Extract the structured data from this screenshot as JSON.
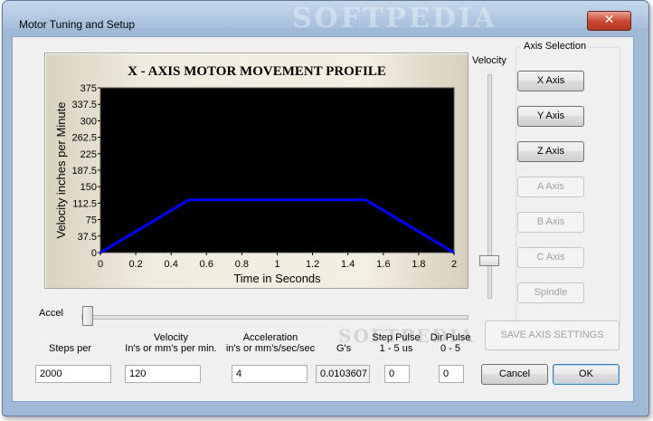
{
  "window": {
    "title": "Motor Tuning and Setup",
    "watermark": "SOFTPEDIA",
    "close_glyph": "✕"
  },
  "chart_data": {
    "type": "line",
    "title": "X - AXIS MOTOR MOVEMENT PROFILE",
    "xlabel": "Time in Seconds",
    "ylabel": "Velocity inches per Minute",
    "xlim": [
      0,
      2
    ],
    "ylim": [
      0,
      375
    ],
    "xticks": [
      "0",
      "0.2",
      "0.4",
      "0.6",
      "0.8",
      "1",
      "1.2",
      "1.4",
      "1.6",
      "1.8",
      "2"
    ],
    "yticks": [
      "0",
      "37.5",
      "75",
      "112.5",
      "150",
      "187.5",
      "225",
      "262.5",
      "300",
      "337.5",
      "375"
    ],
    "series": [
      {
        "x": [
          0,
          0.5,
          1.5,
          2
        ],
        "y": [
          0,
          120,
          120,
          0
        ],
        "color": "#0000ff"
      }
    ],
    "plot_background": "#000000",
    "grid": false
  },
  "sliders": {
    "velocity_label": "Velocity",
    "accel_label": "Accel"
  },
  "axis_selection": {
    "label": "Axis Selection",
    "buttons": [
      {
        "label": "X Axis",
        "enabled": true
      },
      {
        "label": "Y Axis",
        "enabled": true
      },
      {
        "label": "Z Axis",
        "enabled": true
      },
      {
        "label": "A Axis",
        "enabled": false
      },
      {
        "label": "B Axis",
        "enabled": false
      },
      {
        "label": "C Axis",
        "enabled": false
      },
      {
        "label": "Spindle",
        "enabled": false
      }
    ]
  },
  "fields": {
    "steps_per": {
      "label": "Steps per",
      "value": "2000"
    },
    "velocity": {
      "label_line1": "Velocity",
      "label_line2": "In's or mm's per min.",
      "value": "120"
    },
    "acceleration": {
      "label_line1": "Acceleration",
      "label_line2": "in's or mm's/sec/sec",
      "value": "4"
    },
    "gs": {
      "label": "G's",
      "value": "0.0103607"
    },
    "step_pulse": {
      "label_line1": "Step Pulse",
      "label_line2": "1 - 5 us",
      "value": "0"
    },
    "dir_pulse": {
      "label_line1": "Dir Pulse",
      "label_line2": "0 - 5",
      "value": "0"
    }
  },
  "actions": {
    "save": "SAVE AXIS SETTINGS",
    "cancel": "Cancel",
    "ok": "OK"
  }
}
